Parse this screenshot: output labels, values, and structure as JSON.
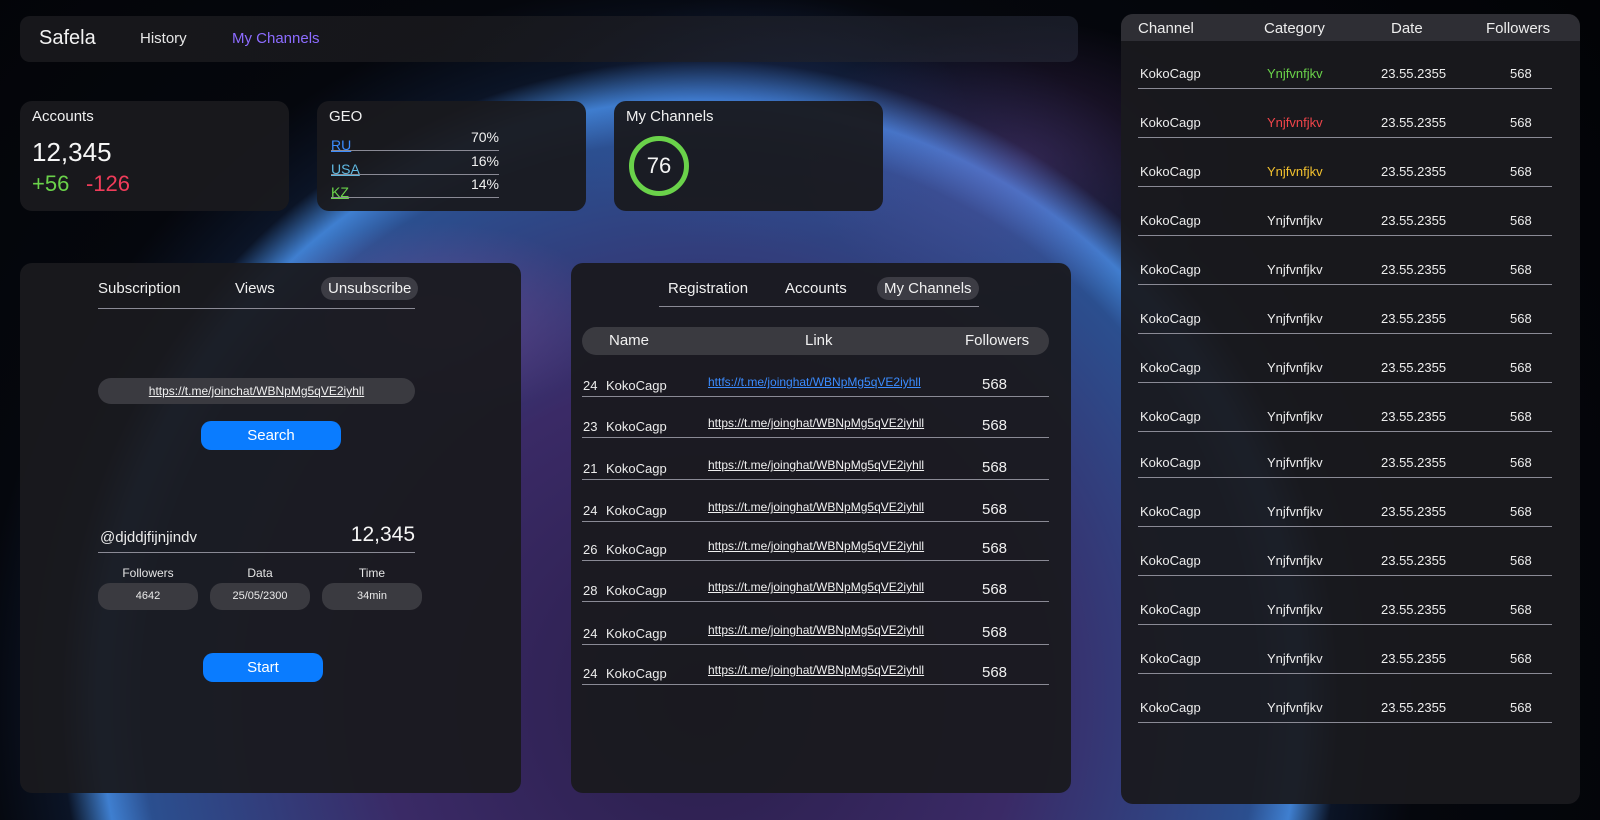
{
  "nav": {
    "brand": "Safela",
    "links": [
      "History",
      "My Channels"
    ]
  },
  "accounts_card": {
    "title": "Accounts",
    "total": "12,345",
    "plus": "+56",
    "minus": "-126"
  },
  "geo_card": {
    "title": "GEO",
    "rows": [
      {
        "code": "RU",
        "pct": "70%",
        "color": "#3b8cff"
      },
      {
        "code": "USA",
        "pct": "16%",
        "color": "#5fb8e0"
      },
      {
        "code": "KZ",
        "pct": "14%",
        "color": "#6ad24a"
      }
    ]
  },
  "channels_card": {
    "title": "My Channels",
    "value": "76",
    "ring_color": "#6ad24a"
  },
  "left_panel": {
    "tabs": [
      "Subscription",
      "Views",
      "Unsubscribe"
    ],
    "url": "https://t.me/joinchat/WBNpMg5qVE2iyhll",
    "search_label": "Search",
    "handle": "@djddjfijnjindv",
    "count": "12,345",
    "stats": [
      {
        "label": "Followers",
        "value": "4642"
      },
      {
        "label": "Data",
        "value": "25/05/2300"
      },
      {
        "label": "Time",
        "value": "34min"
      }
    ],
    "start_label": "Start"
  },
  "mid_panel": {
    "tabs": [
      "Registration",
      "Accounts",
      "My Channels"
    ],
    "headers": [
      "Name",
      "Link",
      "Followers"
    ],
    "rows": [
      {
        "num": "24",
        "name": "KokoCagp",
        "link": "httfs://t.me/joinghat/WBNpMg5qVE2iyhll",
        "followers": "568"
      },
      {
        "num": "23",
        "name": "KokoCagp",
        "link": "https://t.me/joinghat/WBNpMg5qVE2iyhll",
        "followers": "568"
      },
      {
        "num": "21",
        "name": "KokoCagp",
        "link": "https://t.me/joinghat/WBNpMg5qVE2iyhll",
        "followers": "568"
      },
      {
        "num": "24",
        "name": "KokoCagp",
        "link": "https://t.me/joinghat/WBNpMg5qVE2iyhll",
        "followers": "568"
      },
      {
        "num": "26",
        "name": "KokoCagp",
        "link": "https://t.me/joinghat/WBNpMg5qVE2iyhll",
        "followers": "568"
      },
      {
        "num": "28",
        "name": "KokoCagp",
        "link": "https://t.me/joinghat/WBNpMg5qVE2iyhll",
        "followers": "568"
      },
      {
        "num": "24",
        "name": "KokoCagp",
        "link": "https://t.me/joinghat/WBNpMg5qVE2iyhll",
        "followers": "568"
      },
      {
        "num": "24",
        "name": "KokoCagp",
        "link": "https://t.me/joinghat/WBNpMg5qVE2iyhll",
        "followers": "568"
      }
    ]
  },
  "right_panel": {
    "headers": [
      "Channel",
      "Category",
      "Date",
      "Followers"
    ],
    "rows": [
      {
        "channel": "KokoCagp",
        "category": "Ynjfvnfjkv",
        "date": "23.55.2355",
        "followers": "568",
        "cat_color": "#6ad24a"
      },
      {
        "channel": "KokoCagp",
        "category": "Ynjfvnfjkv",
        "date": "23.55.2355",
        "followers": "568",
        "cat_color": "#f0454a"
      },
      {
        "channel": "KokoCagp",
        "category": "Ynjfvnfjkv",
        "date": "23.55.2355",
        "followers": "568",
        "cat_color": "#f2c12e"
      },
      {
        "channel": "KokoCagp",
        "category": "Ynjfvnfjkv",
        "date": "23.55.2355",
        "followers": "568",
        "cat_color": "#ededed"
      },
      {
        "channel": "KokoCagp",
        "category": "Ynjfvnfjkv",
        "date": "23.55.2355",
        "followers": "568",
        "cat_color": "#ededed"
      },
      {
        "channel": "KokoCagp",
        "category": "Ynjfvnfjkv",
        "date": "23.55.2355",
        "followers": "568",
        "cat_color": "#ededed"
      },
      {
        "channel": "KokoCagp",
        "category": "Ynjfvnfjkv",
        "date": "23.55.2355",
        "followers": "568",
        "cat_color": "#ededed"
      },
      {
        "channel": "KokoCagp",
        "category": "Ynjfvnfjkv",
        "date": "23.55.2355",
        "followers": "568",
        "cat_color": "#ededed"
      },
      {
        "channel": "KokoCagp",
        "category": "Ynjfvnfjkv",
        "date": "23.55.2355",
        "followers": "568",
        "cat_color": "#ededed"
      },
      {
        "channel": "KokoCagp",
        "category": "Ynjfvnfjkv",
        "date": "23.55.2355",
        "followers": "568",
        "cat_color": "#ededed"
      },
      {
        "channel": "KokoCagp",
        "category": "Ynjfvnfjkv",
        "date": "23.55.2355",
        "followers": "568",
        "cat_color": "#ededed"
      },
      {
        "channel": "KokoCagp",
        "category": "Ynjfvnfjkv",
        "date": "23.55.2355",
        "followers": "568",
        "cat_color": "#ededed"
      },
      {
        "channel": "KokoCagp",
        "category": "Ynjfvnfjkv",
        "date": "23.55.2355",
        "followers": "568",
        "cat_color": "#ededed"
      },
      {
        "channel": "KokoCagp",
        "category": "Ynjfvnfjkv",
        "date": "23.55.2355",
        "followers": "568",
        "cat_color": "#ededed"
      }
    ]
  },
  "colors": {
    "accent_blue": "#0a7cff",
    "nav_active": "#8c6cff",
    "positive": "#6ad24a",
    "negative": "#f03c5a"
  }
}
